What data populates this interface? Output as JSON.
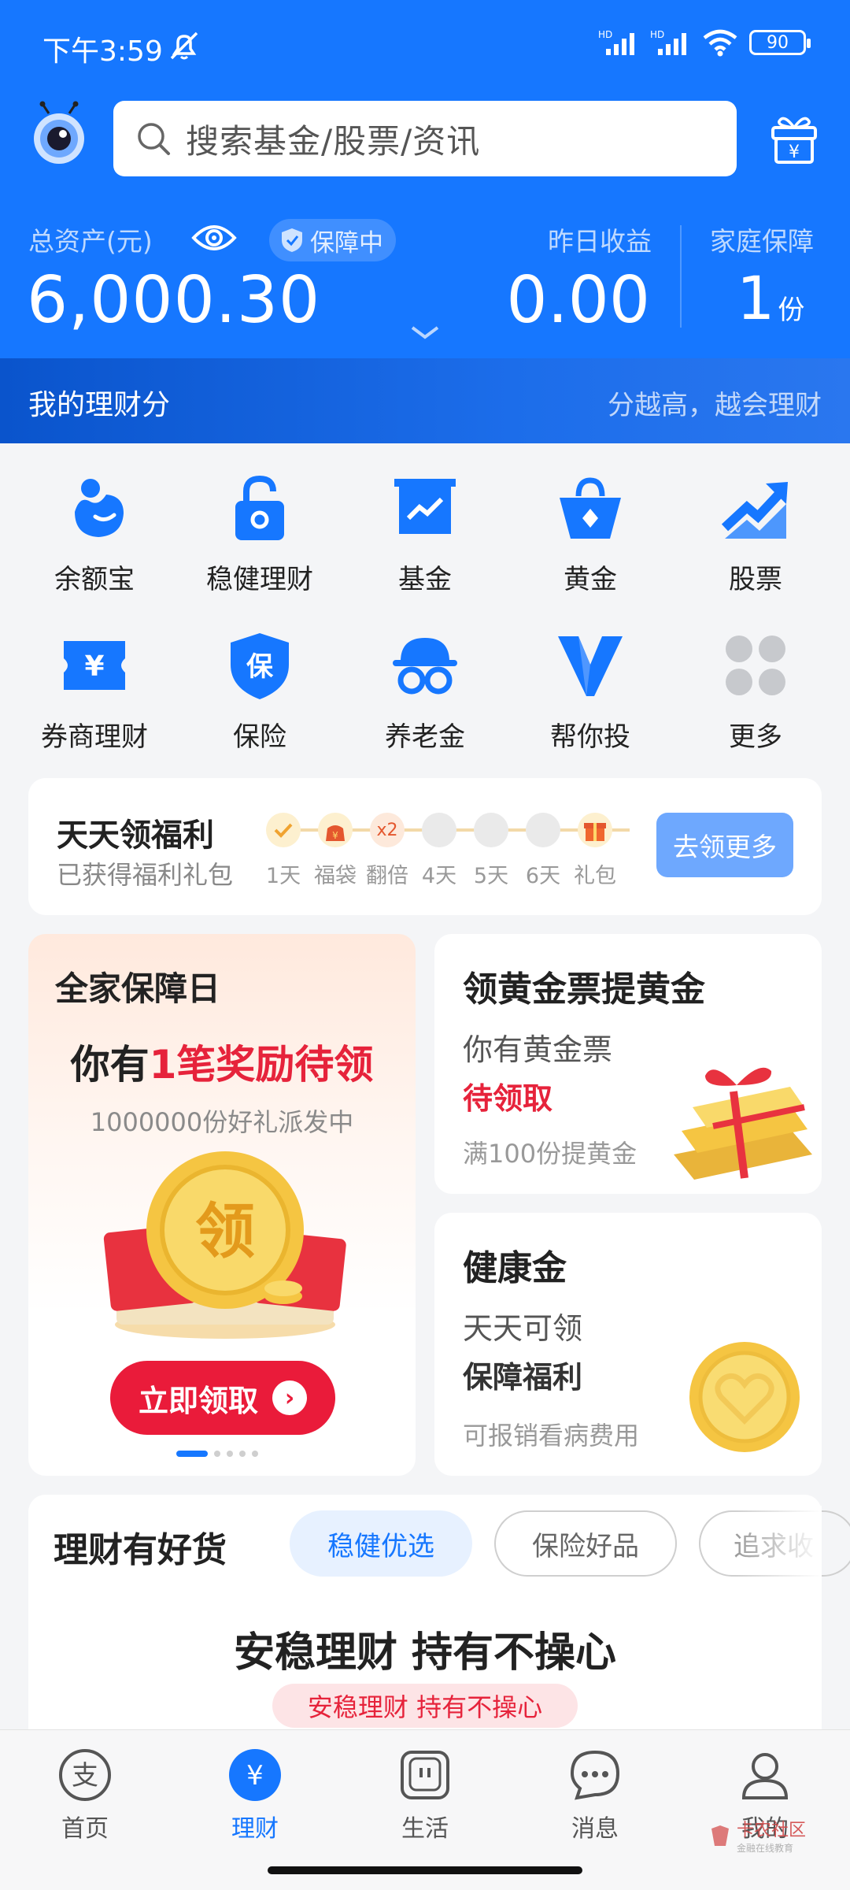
{
  "status_bar": {
    "time": "下午3:59",
    "battery": "90"
  },
  "search": {
    "placeholder": "搜索基金/股票/资讯"
  },
  "assets": {
    "total_label": "总资产(元)",
    "protect_badge": "保障中",
    "total_value": "6,000.30",
    "yesterday_label": "昨日收益",
    "yesterday_value": "0.00",
    "family_label": "家庭保障",
    "family_value": "1",
    "family_unit": "份"
  },
  "score_bar": {
    "title": "我的理财分",
    "hint": "分越高，越会理财"
  },
  "grid": [
    {
      "label": "余额宝",
      "icon": "yuebao-icon"
    },
    {
      "label": "稳健理财",
      "icon": "lock-icon"
    },
    {
      "label": "基金",
      "icon": "fund-chart-icon"
    },
    {
      "label": "黄金",
      "icon": "gold-bag-icon"
    },
    {
      "label": "股票",
      "icon": "stock-trend-icon"
    },
    {
      "label": "券商理财",
      "icon": "ticket-yen-icon"
    },
    {
      "label": "保险",
      "icon": "insurance-shield-icon"
    },
    {
      "label": "养老金",
      "icon": "pension-glasses-icon"
    },
    {
      "label": "帮你投",
      "icon": "v-logo-icon"
    },
    {
      "label": "更多",
      "icon": "more-grid-icon"
    }
  ],
  "welfare": {
    "title": "天天领福利",
    "subtitle": "已获得福利礼包",
    "multiplier": "x2",
    "steps": [
      "1天",
      "福袋",
      "翻倍",
      "4天",
      "5天",
      "6天",
      "礼包"
    ],
    "button": "去领更多"
  },
  "promo_left": {
    "title": "全家保障日",
    "headline_pre": "你有",
    "headline_red": "1笔奖励待领",
    "sub": "1000000份好礼派发中",
    "coin_text": "领",
    "button": "立即领取"
  },
  "promo_gold": {
    "title": "领黄金票提黄金",
    "line1": "你有黄金票",
    "line2": "待领取",
    "note": "满100份提黄金"
  },
  "promo_health": {
    "title": "健康金",
    "line1": "天天可领",
    "line2": "保障福利",
    "note": "可报销看病费用"
  },
  "goods": {
    "title": "理财有好货",
    "tabs": [
      "稳健优选",
      "保险好品",
      "追求收"
    ],
    "headline": "安稳理财 持有不操心",
    "pill": "安稳理财 持有不操心"
  },
  "tabbar": [
    {
      "label": "首页",
      "icon": "alipay-home-icon"
    },
    {
      "label": "理财",
      "icon": "yen-wealth-icon"
    },
    {
      "label": "生活",
      "icon": "life-icon"
    },
    {
      "label": "消息",
      "icon": "message-bubble-icon"
    },
    {
      "label": "我的",
      "icon": "person-icon"
    }
  ],
  "watermark": {
    "text": "卡农社区",
    "sub": "金融在线教育"
  },
  "colors": {
    "brand_blue": "#1677ff",
    "accent_red": "#e6233b",
    "gold": "#f5c542"
  }
}
